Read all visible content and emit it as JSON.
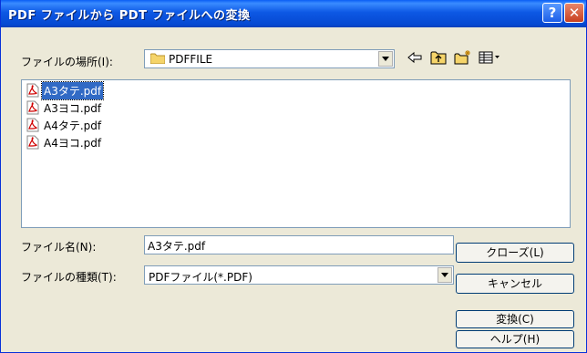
{
  "window": {
    "title": "PDF ファイルから PDT ファイルへの変換"
  },
  "titlebar": {
    "help_label": "?",
    "close_label": "✕"
  },
  "location": {
    "label": "ファイルの場所(I):",
    "value": "PDFFILE"
  },
  "toolbar": {
    "icons": [
      "back-arrow-icon",
      "up-folder-icon",
      "new-folder-icon",
      "view-menu-icon"
    ]
  },
  "files": [
    {
      "name": "A3タテ.pdf",
      "selected": true
    },
    {
      "name": "A3ヨコ.pdf",
      "selected": false
    },
    {
      "name": "A4タテ.pdf",
      "selected": false
    },
    {
      "name": "A4ヨコ.pdf",
      "selected": false
    }
  ],
  "filename": {
    "label": "ファイル名(N):",
    "value": "A3タテ.pdf"
  },
  "filetype": {
    "label": "ファイルの種類(T):",
    "value": "PDFファイル(*.PDF)"
  },
  "buttons": {
    "close": "クローズ(L)",
    "cancel": "キャンセル",
    "convert": "変換(C)",
    "help": "ヘルプ(H)"
  },
  "colors": {
    "title_bar": "#0a5ef5",
    "selection": "#316ac5",
    "dialog_bg": "#ece9d8"
  }
}
